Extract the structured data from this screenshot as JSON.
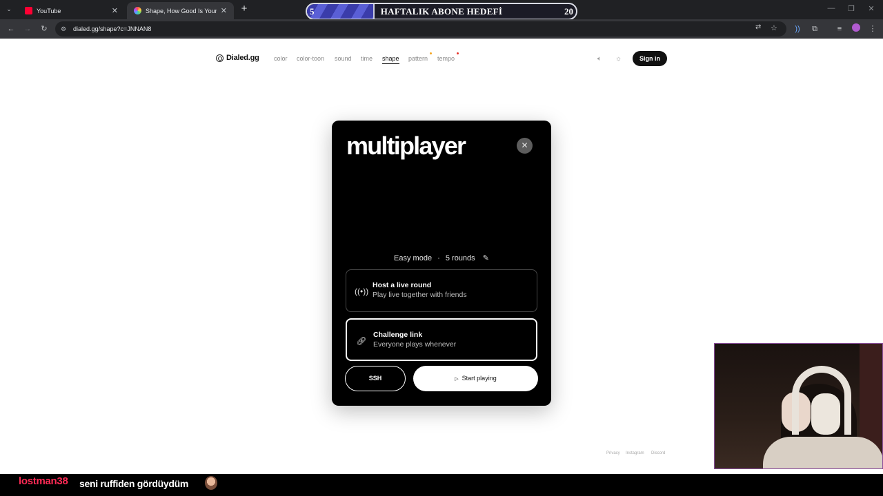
{
  "browser": {
    "tabs": [
      {
        "title": "YouTube",
        "favicon_color": "#ff0033",
        "active": false
      },
      {
        "title": "Shape, How Good Is Your Spati",
        "favicon_color": "#7b6cf0",
        "active": true
      }
    ],
    "new_tab": "+",
    "url": "dialed.gg/shape?c=JNNAN8"
  },
  "goal_overlay": {
    "current": "5",
    "title": "HAFTALIK ABONE HEDEFİ",
    "max": "20",
    "progress": 0.25
  },
  "site": {
    "logo": "Dialed.gg",
    "nav": [
      {
        "label": "color",
        "active": false
      },
      {
        "label": "color-toon",
        "active": false
      },
      {
        "label": "sound",
        "active": false
      },
      {
        "label": "time",
        "active": false
      },
      {
        "label": "shape",
        "active": true
      },
      {
        "label": "pattern",
        "active": false,
        "dot_color": "#f5a623"
      },
      {
        "label": "tempo",
        "active": false,
        "dot_color": "#e5332a"
      }
    ],
    "sign_in": "Sign in"
  },
  "modal": {
    "title": "multiplayer",
    "close_glyph": "✕",
    "mode": "Easy mode",
    "separator": "·",
    "rounds": "5 rounds",
    "options": [
      {
        "title": "Host a live round",
        "subtitle": "Play live together with friends",
        "icon": "broadcast-icon"
      },
      {
        "title": "Challenge link",
        "subtitle": "Everyone plays whenever",
        "icon": "link-icon",
        "selected": true
      }
    ],
    "secondary_button": "SSH",
    "primary_button": "Start playing"
  },
  "footer": {
    "links": [
      "Privacy",
      "Instagram",
      "Discord"
    ]
  },
  "chat": {
    "username": "lostman38",
    "message": "seni ruffiden gördüydüm",
    "username_color": "#ff2a55"
  }
}
